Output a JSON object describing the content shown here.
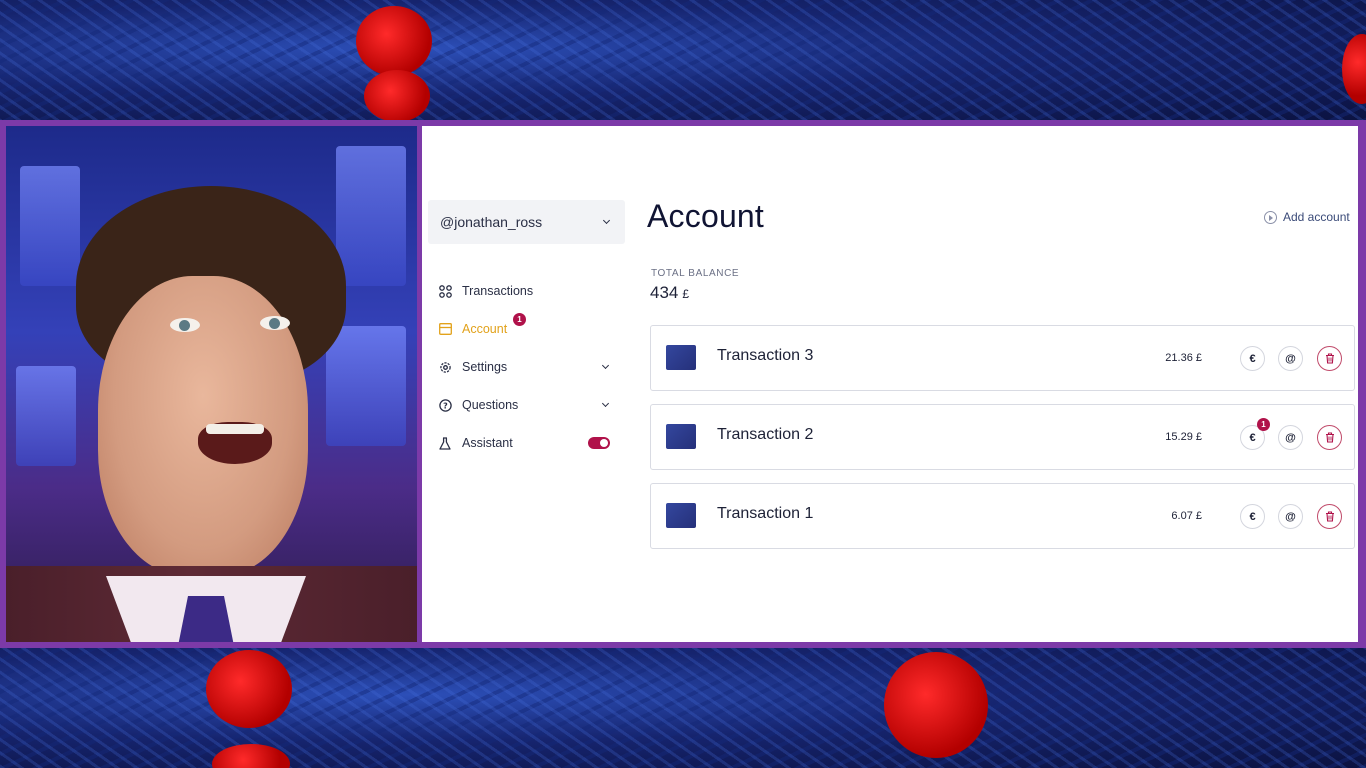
{
  "sidebar": {
    "account_handle": "@jonathan_ross",
    "items": [
      {
        "label": "Transactions",
        "icon": "grid-icon"
      },
      {
        "label": "Account",
        "icon": "card-icon",
        "badge": "1",
        "active": true
      },
      {
        "label": "Settings",
        "icon": "gear-icon",
        "has_chevron": true
      },
      {
        "label": "Questions",
        "icon": "help-circle-icon",
        "has_chevron": true
      },
      {
        "label": "Assistant",
        "icon": "flask-icon",
        "toggle_on": true
      }
    ]
  },
  "main": {
    "title": "Account",
    "add_account_label": "Add account",
    "balance_label": "TOTAL BALANCE",
    "balance_value": "434",
    "balance_currency": "£",
    "transactions": [
      {
        "name": "Transaction 3",
        "amount": "21.36 £",
        "euro_badge": ""
      },
      {
        "name": "Transaction 2",
        "amount": "15.29 £",
        "euro_badge": "1"
      },
      {
        "name": "Transaction 1",
        "amount": "6.07 £",
        "euro_badge": ""
      }
    ],
    "action_glyphs": {
      "euro": "€",
      "at": "@"
    }
  },
  "colors": {
    "accent_active": "#e2a21b",
    "badge": "#b0124a",
    "frame": "#7c3aa8"
  }
}
